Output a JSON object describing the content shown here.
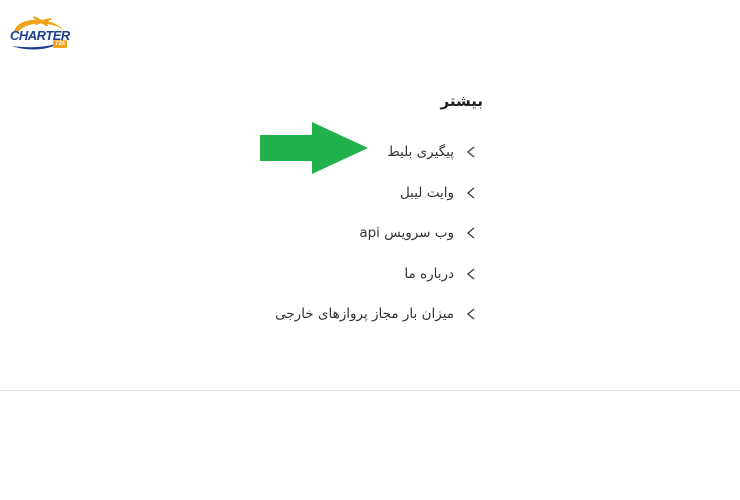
{
  "logo": {
    "text": "CHARTER",
    "sub": "724"
  },
  "menu": {
    "title": "بیشتر",
    "items": [
      {
        "label": "پیگیری بلیط"
      },
      {
        "label": "وایت لیبل"
      },
      {
        "label": "وب سرویس api"
      },
      {
        "label": "درباره ما"
      },
      {
        "label": "میزان بار مجاز پروازهای خارجی"
      }
    ]
  },
  "colors": {
    "arrow": "#22b14c",
    "logo_blue": "#1d3f8f",
    "logo_orange": "#f2a21b",
    "text": "#333333"
  }
}
